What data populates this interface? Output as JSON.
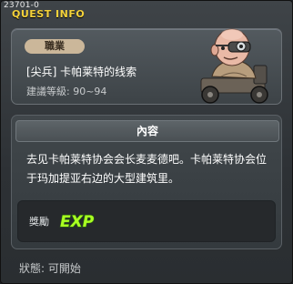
{
  "window": {
    "quest_id": "23701-0",
    "title": "QUEST INFO"
  },
  "header": {
    "job_badge": "職業",
    "quest_name": "[尖兵] 卡帕莱特的线索",
    "level_line": "建議等級: 90~94",
    "npc_portrait": "bald-scientist-with-goggles-in-chair"
  },
  "content": {
    "header": "內容",
    "text": "去见卡帕莱特协会会长麦麦德吧。卡帕莱特协会位于玛加提亚右边的大型建筑里。"
  },
  "reward": {
    "label": "獎勵",
    "exp_label": "EXP",
    "exp_icon": "exp-icon"
  },
  "status": {
    "line": "狀態: 可開始"
  },
  "colors": {
    "title": "#f4d23a",
    "badge": "#cbb79a",
    "exp_green": "#aaff22"
  }
}
